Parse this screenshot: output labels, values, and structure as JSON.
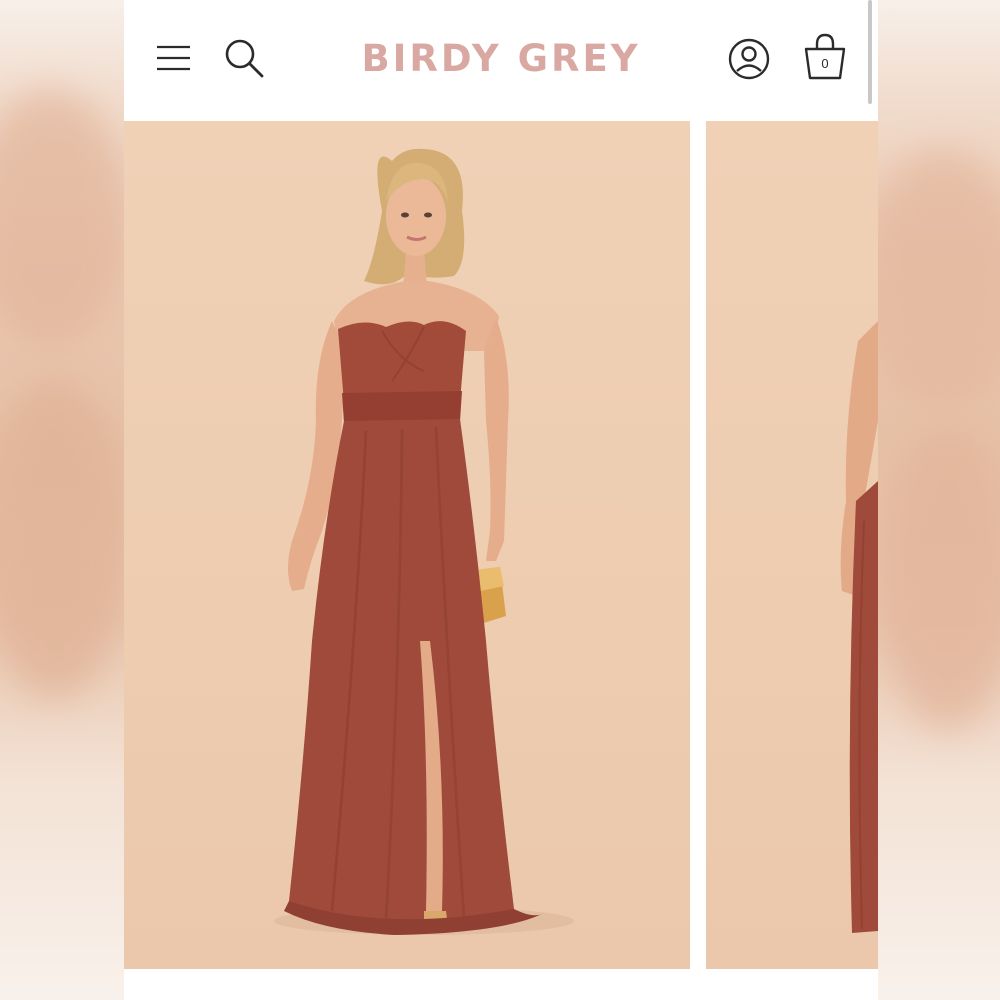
{
  "header": {
    "logo_text": "BIRDY GREY",
    "cart_count": "0",
    "icons": {
      "menu": "hamburger-menu-icon",
      "search": "search-icon",
      "account": "account-icon",
      "cart": "shopping-bag-icon"
    }
  },
  "colors": {
    "logo": "#d9a8a2",
    "backdrop": "#eecdb1",
    "dress": "#9f4a3a",
    "icon_stroke": "#2b2b2b"
  },
  "carousel": {
    "slides": [
      {
        "image": "model-front-strapless-gown-photo"
      },
      {
        "image": "model-side-gown-photo-partial"
      }
    ]
  }
}
